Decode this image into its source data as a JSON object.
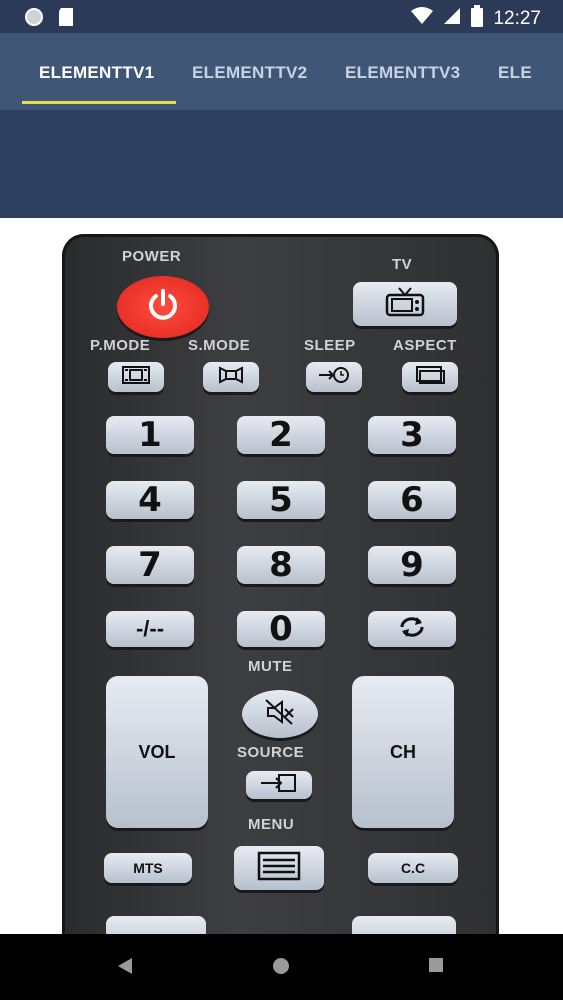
{
  "status": {
    "time": "12:27"
  },
  "tabs": [
    {
      "label": "ELEMENTTV1"
    },
    {
      "label": "ELEMENTTV2"
    },
    {
      "label": "ELEMENTTV3"
    },
    {
      "label": "ELE"
    }
  ],
  "remote": {
    "power_label": "POWER",
    "tv_label": "TV",
    "pmode_label": "P.MODE",
    "smode_label": "S.MODE",
    "sleep_label": "SLEEP",
    "aspect_label": "ASPECT",
    "digits": [
      "1",
      "2",
      "3",
      "4",
      "5",
      "6",
      "7",
      "8",
      "9"
    ],
    "dash_label": "-/--",
    "zero_label": "0",
    "mute_label": "MUTE",
    "vol_label": "VOL",
    "ch_label": "CH",
    "source_label": "SOURCE",
    "menu_label": "MENU",
    "mts_label": "MTS",
    "cc_label": "C.C"
  },
  "colors": {
    "status_bar": "#2b3a57",
    "tab_bar": "#3f5677",
    "indicator": "#e7de52",
    "power": "#e0251c"
  }
}
